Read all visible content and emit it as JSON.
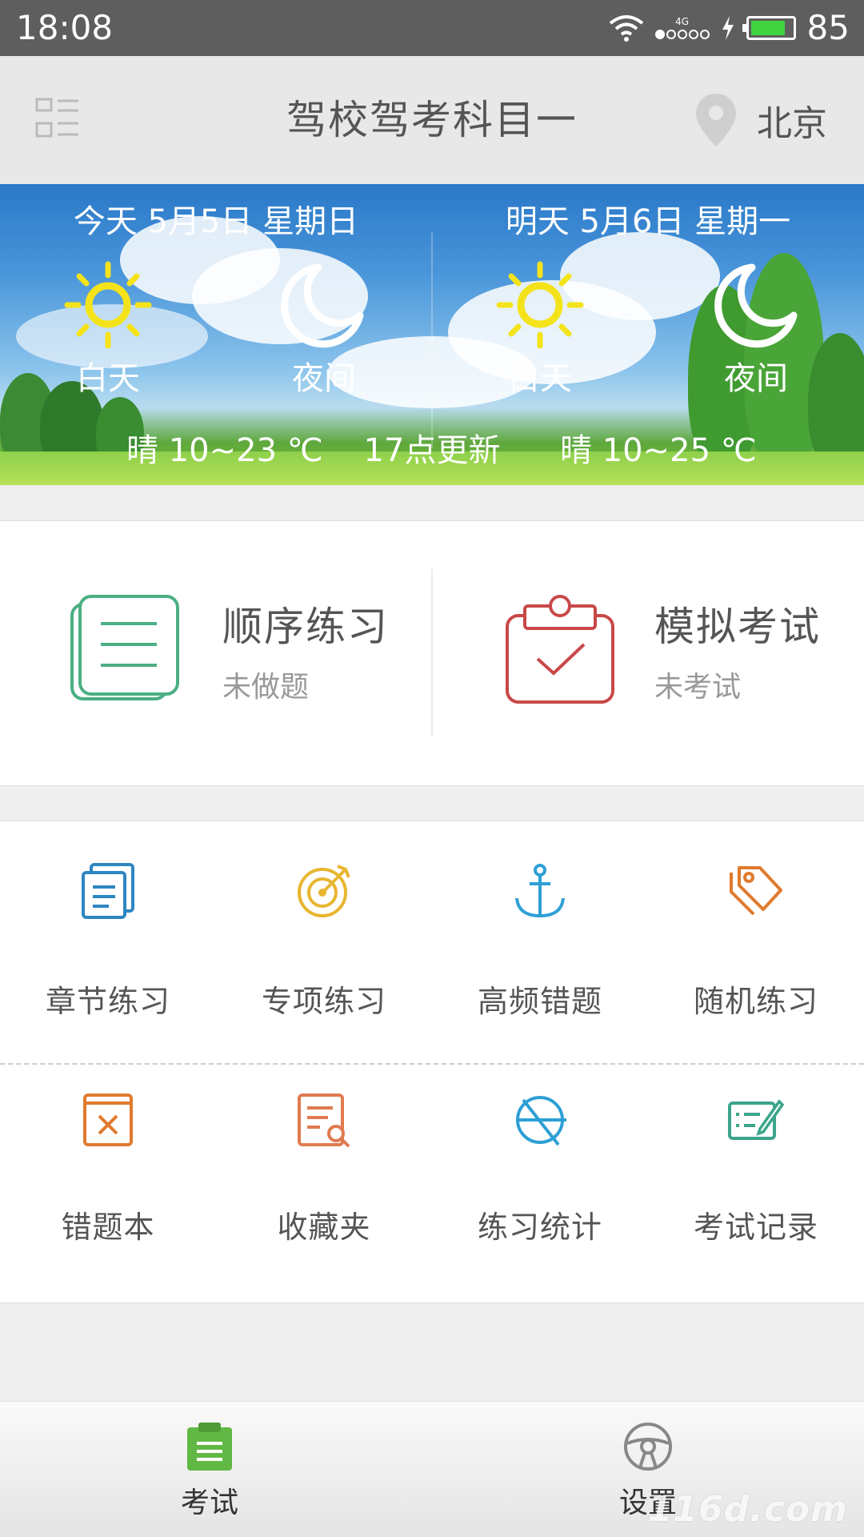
{
  "status_bar": {
    "time": "18:08",
    "network": "4G",
    "battery_level": "85"
  },
  "header": {
    "title": "驾校驾考科目一",
    "city": "北京"
  },
  "weather": {
    "today": {
      "date": "今天 5月5日 星期日",
      "day_label": "白天",
      "night_label": "夜间",
      "summary": "晴 10~23 ℃"
    },
    "update_text": "17点更新",
    "tomorrow": {
      "date": "明天 5月6日 星期一",
      "day_label": "白天",
      "night_label": "夜间",
      "summary": "晴 10~25 ℃"
    }
  },
  "main_actions": [
    {
      "title": "顺序练习",
      "subtitle": "未做题",
      "icon": "list-icon",
      "color": "#4caf84"
    },
    {
      "title": "模拟考试",
      "subtitle": "未考试",
      "icon": "clipboard-check-icon",
      "color": "#c94848"
    }
  ],
  "grid": {
    "row1": [
      {
        "label": "章节练习",
        "icon": "documents-icon",
        "color": "#2e86c1"
      },
      {
        "label": "专项练习",
        "icon": "target-icon",
        "color": "#e8b530"
      },
      {
        "label": "高频错题",
        "icon": "anchor-icon",
        "color": "#2e9fd6"
      },
      {
        "label": "随机练习",
        "icon": "tags-icon",
        "color": "#e07a2e"
      }
    ],
    "row2": [
      {
        "label": "错题本",
        "icon": "wrong-book-icon",
        "color": "#e07a2e"
      },
      {
        "label": "收藏夹",
        "icon": "favorites-search-icon",
        "color": "#e07a50"
      },
      {
        "label": "练习统计",
        "icon": "statistics-icon",
        "color": "#2e9fd6"
      },
      {
        "label": "考试记录",
        "icon": "exam-record-icon",
        "color": "#3aa58a"
      }
    ]
  },
  "bottom_nav": [
    {
      "label": "考试",
      "icon": "exam-tab-icon",
      "active": true,
      "color": "#62b845"
    },
    {
      "label": "设置",
      "icon": "steering-wheel-icon",
      "active": false,
      "color": "#888888"
    }
  ],
  "watermark": "116d.com"
}
